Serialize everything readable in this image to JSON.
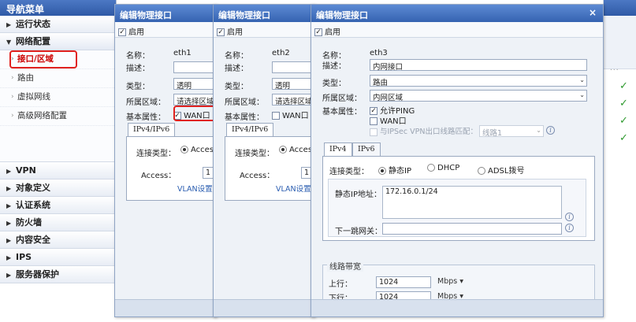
{
  "sidebar": {
    "title": "导航菜单",
    "items_top": [
      {
        "label": "运行状态",
        "arrow": "▶"
      },
      {
        "label": "网络配置",
        "arrow": "▼"
      }
    ],
    "sub_items": [
      {
        "label": "接口/区域"
      },
      {
        "label": "路由"
      },
      {
        "label": "虚拟网线"
      },
      {
        "label": "高级网络配置"
      }
    ],
    "items_bottom": [
      {
        "label": "VPN",
        "arrow": "▶"
      },
      {
        "label": "对象定义",
        "arrow": "▶"
      },
      {
        "label": "认证系统",
        "arrow": "▶"
      },
      {
        "label": "防火墙",
        "arrow": "▶"
      },
      {
        "label": "内容安全",
        "arrow": "▶"
      },
      {
        "label": "IPS",
        "arrow": "▶"
      },
      {
        "label": "服务器保护",
        "arrow": "▶"
      }
    ]
  },
  "background": {
    "pager": "...",
    "check": "✓"
  },
  "dialog1": {
    "title": "编辑物理接口",
    "enable_label": "启用",
    "name_label": "名称：",
    "name_value": "eth1",
    "desc_label": "描述：",
    "type_label": "类型：",
    "type_value": "透明",
    "zone_label": "所属区域：",
    "zone_value": "请选择区域",
    "attr_label": "基本属性：",
    "wan_label": "WAN口",
    "tab_ipv46": "IPv4/IPv6",
    "conn_label": "连接类型：",
    "conn_value": "Access",
    "access_label": "Access：",
    "access_value": "1",
    "vlan_link": "VLAN设置"
  },
  "dialog2": {
    "title": "编辑物理接口",
    "enable_label": "启用",
    "name_label": "名称：",
    "name_value": "eth2",
    "desc_label": "描述：",
    "type_label": "类型：",
    "type_value": "透明",
    "zone_label": "所属区域：",
    "zone_value": "请选择区域",
    "attr_label": "基本属性：",
    "wan_label": "WAN口",
    "tab_ipv46": "IPv4/IPv6",
    "conn_label": "连接类型：",
    "conn_value": "Access",
    "access_label": "Access：",
    "access_value": "1",
    "vlan_link": "VLAN设置"
  },
  "dialog3": {
    "title": "编辑物理接口",
    "close": "×",
    "enable_label": "启用",
    "name_label": "名称：",
    "name_value": "eth3",
    "desc_label": "描述：",
    "desc_value": "内网接口",
    "type_label": "类型：",
    "type_value": "路由",
    "zone_label": "所属区域：",
    "zone_value": "内网区域",
    "attr_label": "基本属性：",
    "ping_label": "允许PING",
    "wan_label": "WAN口",
    "ipsec_label": "与IPSec VPN出口线路匹配：",
    "line_value": "线路1",
    "tab_ipv4": "IPv4",
    "tab_ipv6": "IPv6",
    "conn_label": "连接类型：",
    "opt_static": "静态IP",
    "opt_dhcp": "DHCP",
    "opt_adsl": "ADSL拨号",
    "ip_label": "静态IP地址：",
    "ip_value": "172.16.0.1/24",
    "gateway_label": "下一跳网关：",
    "bandwidth_legend": "线路带宽",
    "up_label": "上行：",
    "up_value": "1024",
    "up_unit": "Mbps ▾",
    "down_label": "下行：",
    "down_value": "1024",
    "down_unit": "Mbps ▾",
    "info_icon": "i"
  }
}
